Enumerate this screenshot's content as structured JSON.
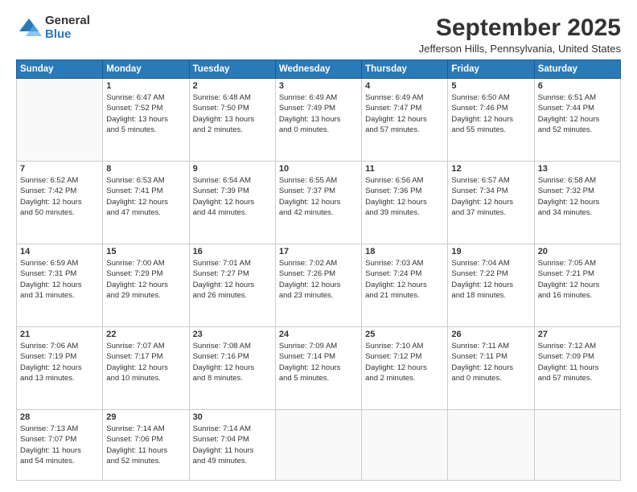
{
  "logo": {
    "general": "General",
    "blue": "Blue"
  },
  "header": {
    "month": "September 2025",
    "location": "Jefferson Hills, Pennsylvania, United States"
  },
  "days": [
    "Sunday",
    "Monday",
    "Tuesday",
    "Wednesday",
    "Thursday",
    "Friday",
    "Saturday"
  ],
  "weeks": [
    [
      {
        "day": null,
        "lines": []
      },
      {
        "day": "1",
        "lines": [
          "Sunrise: 6:47 AM",
          "Sunset: 7:52 PM",
          "Daylight: 13 hours",
          "and 5 minutes."
        ]
      },
      {
        "day": "2",
        "lines": [
          "Sunrise: 6:48 AM",
          "Sunset: 7:50 PM",
          "Daylight: 13 hours",
          "and 2 minutes."
        ]
      },
      {
        "day": "3",
        "lines": [
          "Sunrise: 6:49 AM",
          "Sunset: 7:49 PM",
          "Daylight: 13 hours",
          "and 0 minutes."
        ]
      },
      {
        "day": "4",
        "lines": [
          "Sunrise: 6:49 AM",
          "Sunset: 7:47 PM",
          "Daylight: 12 hours",
          "and 57 minutes."
        ]
      },
      {
        "day": "5",
        "lines": [
          "Sunrise: 6:50 AM",
          "Sunset: 7:46 PM",
          "Daylight: 12 hours",
          "and 55 minutes."
        ]
      },
      {
        "day": "6",
        "lines": [
          "Sunrise: 6:51 AM",
          "Sunset: 7:44 PM",
          "Daylight: 12 hours",
          "and 52 minutes."
        ]
      }
    ],
    [
      {
        "day": "7",
        "lines": [
          "Sunrise: 6:52 AM",
          "Sunset: 7:42 PM",
          "Daylight: 12 hours",
          "and 50 minutes."
        ]
      },
      {
        "day": "8",
        "lines": [
          "Sunrise: 6:53 AM",
          "Sunset: 7:41 PM",
          "Daylight: 12 hours",
          "and 47 minutes."
        ]
      },
      {
        "day": "9",
        "lines": [
          "Sunrise: 6:54 AM",
          "Sunset: 7:39 PM",
          "Daylight: 12 hours",
          "and 44 minutes."
        ]
      },
      {
        "day": "10",
        "lines": [
          "Sunrise: 6:55 AM",
          "Sunset: 7:37 PM",
          "Daylight: 12 hours",
          "and 42 minutes."
        ]
      },
      {
        "day": "11",
        "lines": [
          "Sunrise: 6:56 AM",
          "Sunset: 7:36 PM",
          "Daylight: 12 hours",
          "and 39 minutes."
        ]
      },
      {
        "day": "12",
        "lines": [
          "Sunrise: 6:57 AM",
          "Sunset: 7:34 PM",
          "Daylight: 12 hours",
          "and 37 minutes."
        ]
      },
      {
        "day": "13",
        "lines": [
          "Sunrise: 6:58 AM",
          "Sunset: 7:32 PM",
          "Daylight: 12 hours",
          "and 34 minutes."
        ]
      }
    ],
    [
      {
        "day": "14",
        "lines": [
          "Sunrise: 6:59 AM",
          "Sunset: 7:31 PM",
          "Daylight: 12 hours",
          "and 31 minutes."
        ]
      },
      {
        "day": "15",
        "lines": [
          "Sunrise: 7:00 AM",
          "Sunset: 7:29 PM",
          "Daylight: 12 hours",
          "and 29 minutes."
        ]
      },
      {
        "day": "16",
        "lines": [
          "Sunrise: 7:01 AM",
          "Sunset: 7:27 PM",
          "Daylight: 12 hours",
          "and 26 minutes."
        ]
      },
      {
        "day": "17",
        "lines": [
          "Sunrise: 7:02 AM",
          "Sunset: 7:26 PM",
          "Daylight: 12 hours",
          "and 23 minutes."
        ]
      },
      {
        "day": "18",
        "lines": [
          "Sunrise: 7:03 AM",
          "Sunset: 7:24 PM",
          "Daylight: 12 hours",
          "and 21 minutes."
        ]
      },
      {
        "day": "19",
        "lines": [
          "Sunrise: 7:04 AM",
          "Sunset: 7:22 PM",
          "Daylight: 12 hours",
          "and 18 minutes."
        ]
      },
      {
        "day": "20",
        "lines": [
          "Sunrise: 7:05 AM",
          "Sunset: 7:21 PM",
          "Daylight: 12 hours",
          "and 16 minutes."
        ]
      }
    ],
    [
      {
        "day": "21",
        "lines": [
          "Sunrise: 7:06 AM",
          "Sunset: 7:19 PM",
          "Daylight: 12 hours",
          "and 13 minutes."
        ]
      },
      {
        "day": "22",
        "lines": [
          "Sunrise: 7:07 AM",
          "Sunset: 7:17 PM",
          "Daylight: 12 hours",
          "and 10 minutes."
        ]
      },
      {
        "day": "23",
        "lines": [
          "Sunrise: 7:08 AM",
          "Sunset: 7:16 PM",
          "Daylight: 12 hours",
          "and 8 minutes."
        ]
      },
      {
        "day": "24",
        "lines": [
          "Sunrise: 7:09 AM",
          "Sunset: 7:14 PM",
          "Daylight: 12 hours",
          "and 5 minutes."
        ]
      },
      {
        "day": "25",
        "lines": [
          "Sunrise: 7:10 AM",
          "Sunset: 7:12 PM",
          "Daylight: 12 hours",
          "and 2 minutes."
        ]
      },
      {
        "day": "26",
        "lines": [
          "Sunrise: 7:11 AM",
          "Sunset: 7:11 PM",
          "Daylight: 12 hours",
          "and 0 minutes."
        ]
      },
      {
        "day": "27",
        "lines": [
          "Sunrise: 7:12 AM",
          "Sunset: 7:09 PM",
          "Daylight: 11 hours",
          "and 57 minutes."
        ]
      }
    ],
    [
      {
        "day": "28",
        "lines": [
          "Sunrise: 7:13 AM",
          "Sunset: 7:07 PM",
          "Daylight: 11 hours",
          "and 54 minutes."
        ]
      },
      {
        "day": "29",
        "lines": [
          "Sunrise: 7:14 AM",
          "Sunset: 7:06 PM",
          "Daylight: 11 hours",
          "and 52 minutes."
        ]
      },
      {
        "day": "30",
        "lines": [
          "Sunrise: 7:14 AM",
          "Sunset: 7:04 PM",
          "Daylight: 11 hours",
          "and 49 minutes."
        ]
      },
      {
        "day": null,
        "lines": []
      },
      {
        "day": null,
        "lines": []
      },
      {
        "day": null,
        "lines": []
      },
      {
        "day": null,
        "lines": []
      }
    ]
  ]
}
